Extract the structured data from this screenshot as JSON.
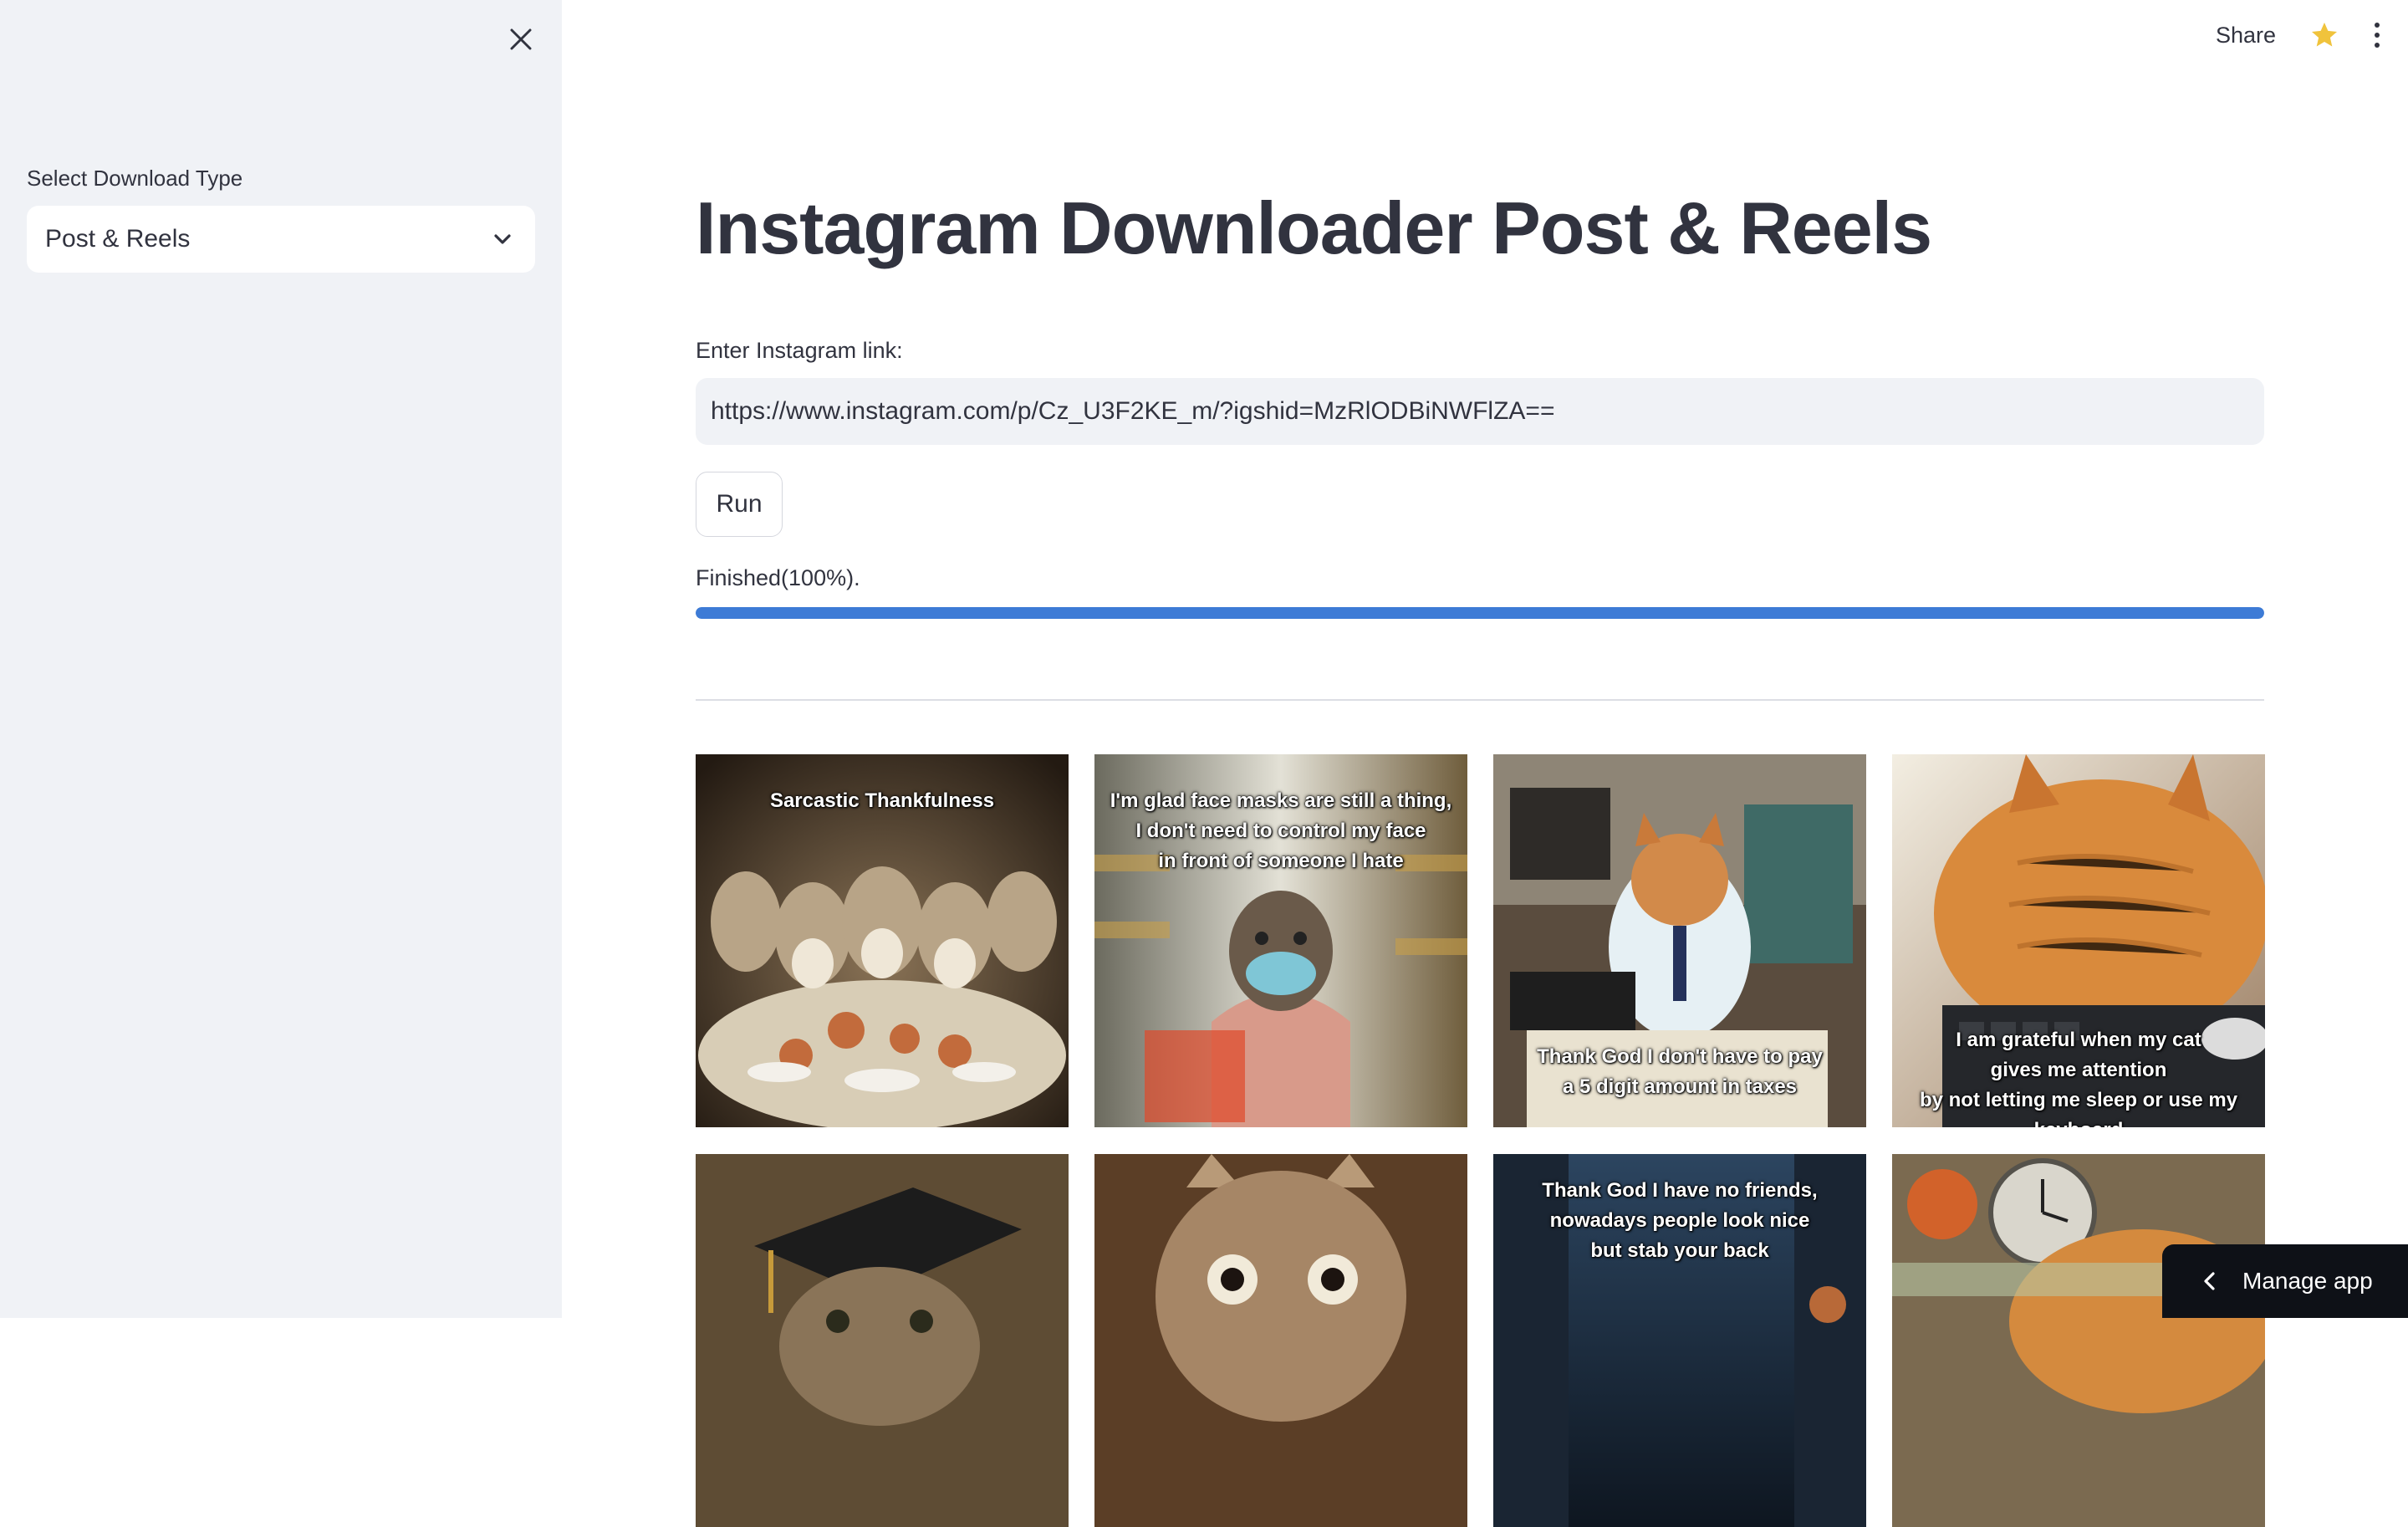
{
  "sidebar": {
    "close_icon": "close-icon",
    "select_label": "Select Download Type",
    "select_value": "Post & Reels"
  },
  "header": {
    "share_label": "Share",
    "star_color": "#f0c33c"
  },
  "main": {
    "title": "Instagram Downloader Post & Reels",
    "input_label": "Enter Instagram link:",
    "input_value": "https://www.instagram.com/p/Cz_U3F2KE_m/?igshid=MzRlODBiNWFlZA==",
    "run_label": "Run",
    "status_text": "Finished(100%).",
    "progress": 1.0,
    "accent_color": "#3d7bd6"
  },
  "gallery": {
    "images": [
      {
        "caption": "Sarcastic Thankfulness"
      },
      {
        "caption": "I'm glad face masks are still a thing,\nI don't need to control my face\nin front of someone I hate"
      },
      {
        "caption": "Thank God I don't have to pay\na 5 digit amount in taxes"
      },
      {
        "caption": "I am grateful when my cat\ngives me attention\nby not letting me sleep or use my keyboard"
      },
      {
        "caption": ""
      },
      {
        "caption": ""
      },
      {
        "caption": "Thank God I have no friends,\nnowadays people look nice\nbut stab your back"
      },
      {
        "caption": ""
      }
    ]
  },
  "footer": {
    "manage_label": "Manage app"
  }
}
